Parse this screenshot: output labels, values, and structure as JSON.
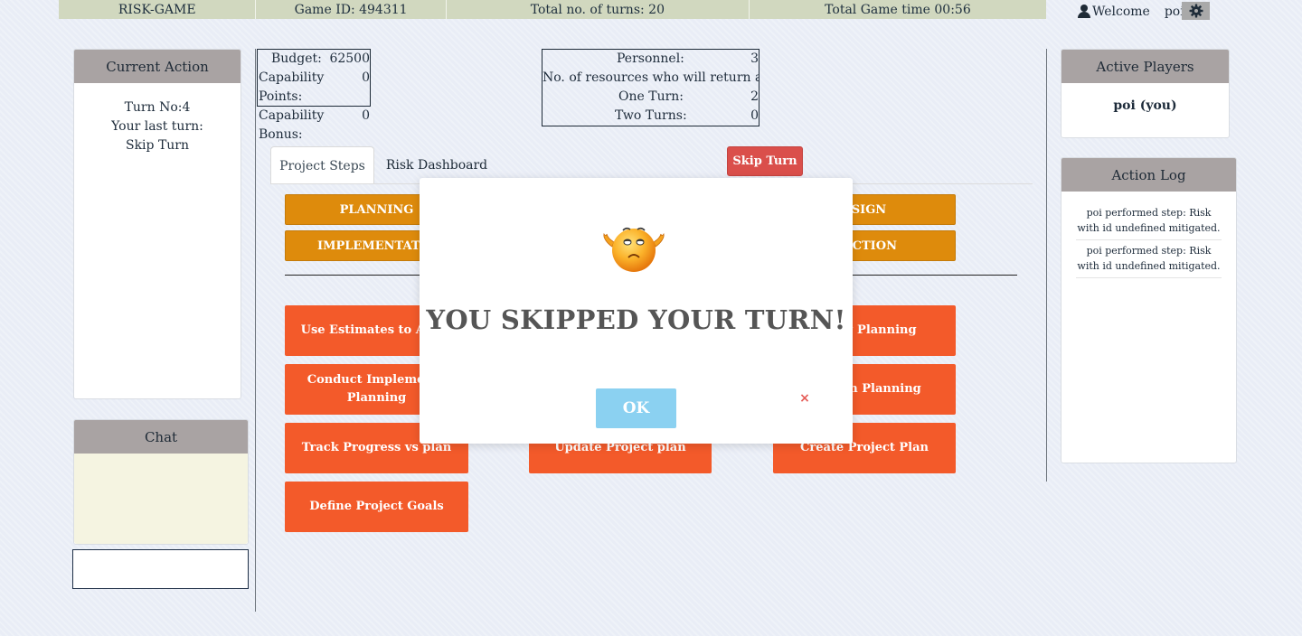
{
  "topbar": {
    "app_name": "RISK-GAME",
    "game_id": "Game ID: 494311",
    "turns": "Total no. of turns: 20",
    "game_time": "Total Game time 00:56",
    "welcome": "Welcome",
    "user": "poi!",
    "settings_icon": "gear-icon",
    "user_icon": "user-icon"
  },
  "current_action": {
    "title": "Current Action",
    "turn": "Turn No:4",
    "last_turn_label": "Your last turn:",
    "last_turn_value": "Skip Turn"
  },
  "chat": {
    "title": "Chat",
    "input_value": ""
  },
  "stats": {
    "budget_label": "Budget:",
    "budget_value": "62500",
    "cap_points_label": "Capability Points:",
    "cap_points_value": "0",
    "cap_bonus_label": "Capability Bonus:",
    "cap_bonus_value": "0",
    "personnel_label": "Personnel:",
    "personnel_value": "3",
    "resources_label": "No. of resources who will return after",
    "one_turn_label": "One Turn:",
    "one_turn_value": "2",
    "two_turns_label": "Two Turns:",
    "two_turns_value": "0"
  },
  "tabs": {
    "steps": "Project Steps",
    "risk": "Risk Dashboard"
  },
  "skip_turn": "Skip Turn",
  "phases": {
    "planning": "PLANNING",
    "design": "ESIGN",
    "implementation": "IMPLEMENTATIO",
    "production": "DUCTION"
  },
  "steps": {
    "use_estimates": "Use Estimates to Adjus",
    "testing_planning": "esting Planning",
    "conduct_impl": "Conduct Implementa Planning",
    "production_planning": "duction Planning",
    "track_progress": "Track Progress vs plan",
    "update_plan": "Update Project plan",
    "create_plan": "Create Project Plan",
    "define_goals": "Define Project Goals"
  },
  "active_players": {
    "title": "Active Players",
    "player": "poi (you)"
  },
  "action_log": {
    "title": "Action Log",
    "entries": [
      "poi performed step: Risk with id undefined mitigated.",
      "poi performed step: Risk with id undefined mitigated."
    ]
  },
  "modal": {
    "message": "YOU SKIPPED YOUR TURN!",
    "ok": "OK",
    "close": "×",
    "emoji_icon": "shrug-emoji-icon"
  }
}
